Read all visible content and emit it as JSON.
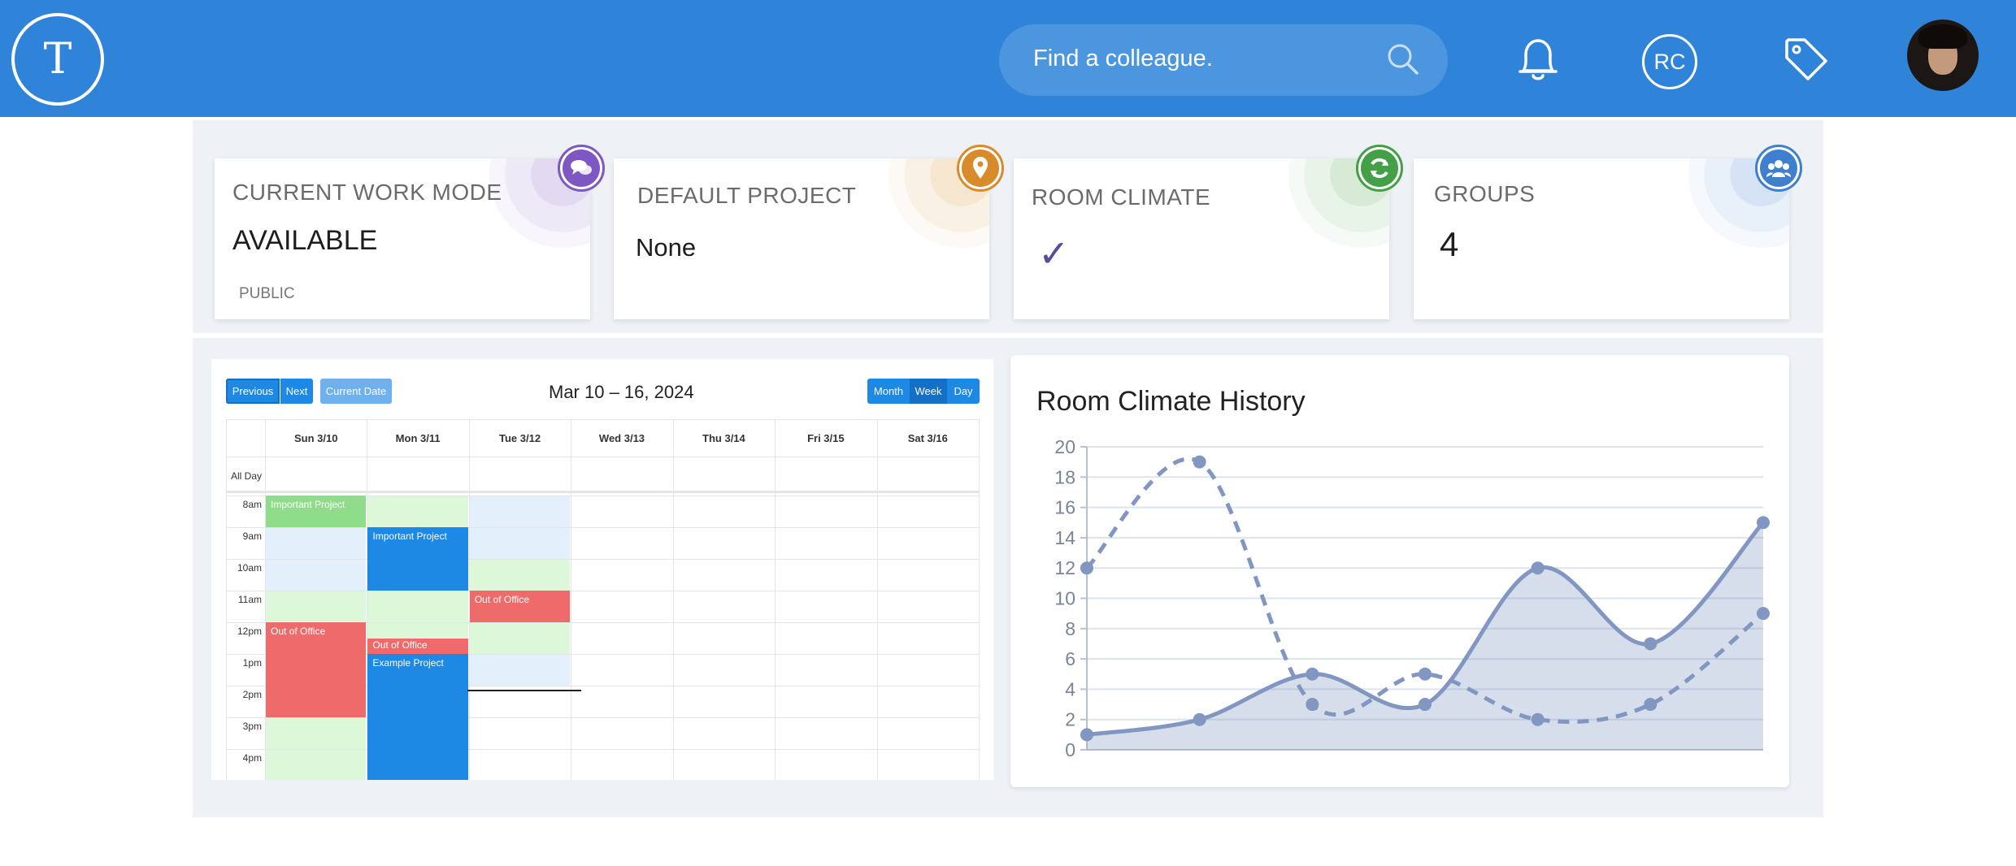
{
  "header": {
    "logo_letter": "T",
    "search_placeholder": "Find a colleague.",
    "user_initials": "RC",
    "icons": [
      "search-icon",
      "bell-icon",
      "tag-icon",
      "avatar"
    ],
    "bar_color": "#2f84d9"
  },
  "cards": [
    {
      "title": "CURRENT WORK MODE",
      "value": "AVAILABLE",
      "sub": "PUBLIC",
      "icon": "chat-icon",
      "color": "#7e57c2"
    },
    {
      "title": "DEFAULT PROJECT",
      "value": "None",
      "icon": "location-pin-icon",
      "color": "#d98b2b"
    },
    {
      "title": "ROOM CLIMATE",
      "value": "✓",
      "icon": "refresh-icon",
      "color": "#43a047"
    },
    {
      "title": "GROUPS",
      "value": "4",
      "icon": "group-icon",
      "color": "#3f7fd0"
    }
  ],
  "calendar": {
    "buttons": {
      "previous": "Previous",
      "next": "Next",
      "current_date": "Current Date",
      "month": "Month",
      "week": "Week",
      "day": "Day"
    },
    "active_view": "Week",
    "title": "Mar 10 – 16, 2024",
    "days": [
      "Sun 3/10",
      "Mon 3/11",
      "Tue 3/12",
      "Wed 3/13",
      "Thu 3/14",
      "Fri 3/15",
      "Sat 3/16"
    ],
    "all_day_label": "All Day",
    "times": [
      "8am",
      "9am",
      "10am",
      "11am",
      "12pm",
      "1pm",
      "2pm",
      "3pm",
      "4pm"
    ],
    "events": [
      {
        "day": 0,
        "start": 8,
        "end": 9,
        "title": "Important Project",
        "color": "#8fdc8a"
      },
      {
        "day": 1,
        "start": 9,
        "end": 11,
        "title": "Important Project",
        "color": "#1e88e5"
      },
      {
        "day": 2,
        "start": 11,
        "end": 12,
        "title": "Out of Office",
        "color": "#ef6b6b"
      },
      {
        "day": 0,
        "start": 12,
        "end": 15,
        "title": "Out of Office",
        "color": "#ef6b6b"
      },
      {
        "day": 1,
        "start": 12.5,
        "end": 13,
        "title": "Out of Office",
        "color": "#ef6b6b"
      },
      {
        "day": 1,
        "start": 13,
        "end": 17,
        "title": "Example Project",
        "color": "#1e88e5"
      }
    ]
  },
  "chart": {
    "title": "Room Climate History"
  },
  "chart_data": {
    "type": "area",
    "title": "Room Climate History",
    "x": [
      0,
      1,
      2,
      3,
      4,
      5,
      6
    ],
    "ylim": [
      0,
      20
    ],
    "yticks": [
      0,
      2,
      4,
      6,
      8,
      10,
      12,
      14,
      16,
      18,
      20
    ],
    "grid": true,
    "series": [
      {
        "values": [
          1,
          2,
          5,
          3,
          12,
          7,
          15
        ],
        "style": "solid-filled",
        "color": "#8196c0"
      },
      {
        "values": [
          12,
          19,
          3,
          5,
          2,
          3,
          9
        ],
        "style": "dashed",
        "color": "#8196c0"
      }
    ]
  }
}
